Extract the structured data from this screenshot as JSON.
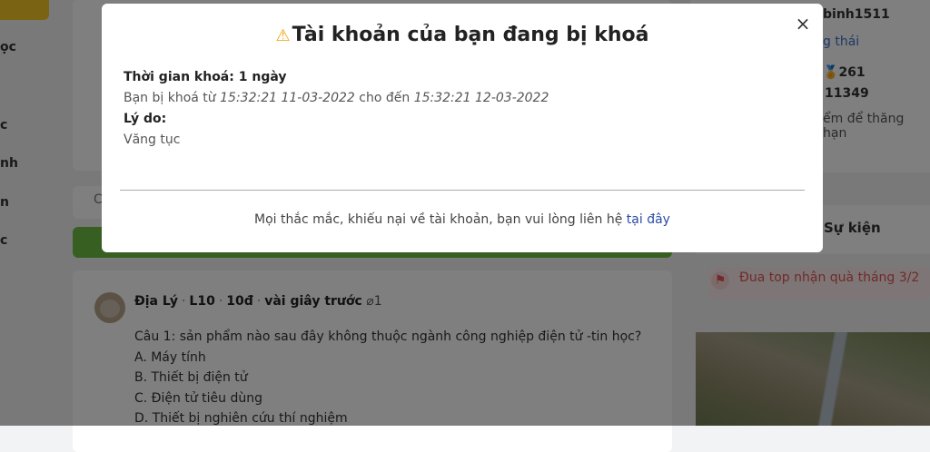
{
  "background": {
    "left_rail_items": [
      "ọc",
      "c",
      "nh",
      "n",
      "c"
    ],
    "tab_fragment": "C",
    "right_panel": {
      "username": "binh1511",
      "status": "g thái",
      "coins": "261",
      "points": "11349",
      "hint": "ểm để thăng hạn"
    },
    "events": {
      "title": "Sự kiện",
      "item": "Đua top nhận quà tháng 3/2"
    },
    "post": {
      "subject": "Địa Lý",
      "grade": "L10",
      "points": "10đ",
      "time": "vài giây trước",
      "attachments": "1",
      "question": "Câu 1: sản phẩm nào sau đây không thuộc ngành công nghiệp điện tử -tin học?",
      "options": [
        "A. Máy tính",
        "B. Thiết bị điện tử",
        "C. Điện tử tiêu dùng",
        "D. Thiết bị nghiên cứu thí nghiệm"
      ]
    }
  },
  "modal": {
    "title": "Tài khoản của bạn đang bị khoá",
    "lock_duration": "Thời gian khoá: 1 ngày",
    "range_prefix": "Bạn bị khoá từ ",
    "from": "15:32:21 11-03-2022",
    "range_mid": " cho đến ",
    "to": "15:32:21 12-03-2022",
    "reason_label": "Lý do:",
    "reason": "Văng tục",
    "footer_text": "Mọi thắc mắc, khiếu nại về tài khoản, bạn vui lòng liên hệ ",
    "footer_link": "tại đây",
    "close": "×"
  },
  "colors": {
    "accent_green": "#6fbe44",
    "warning": "#f2a300",
    "link": "#2b4ba8",
    "event_red": "#e05454"
  }
}
